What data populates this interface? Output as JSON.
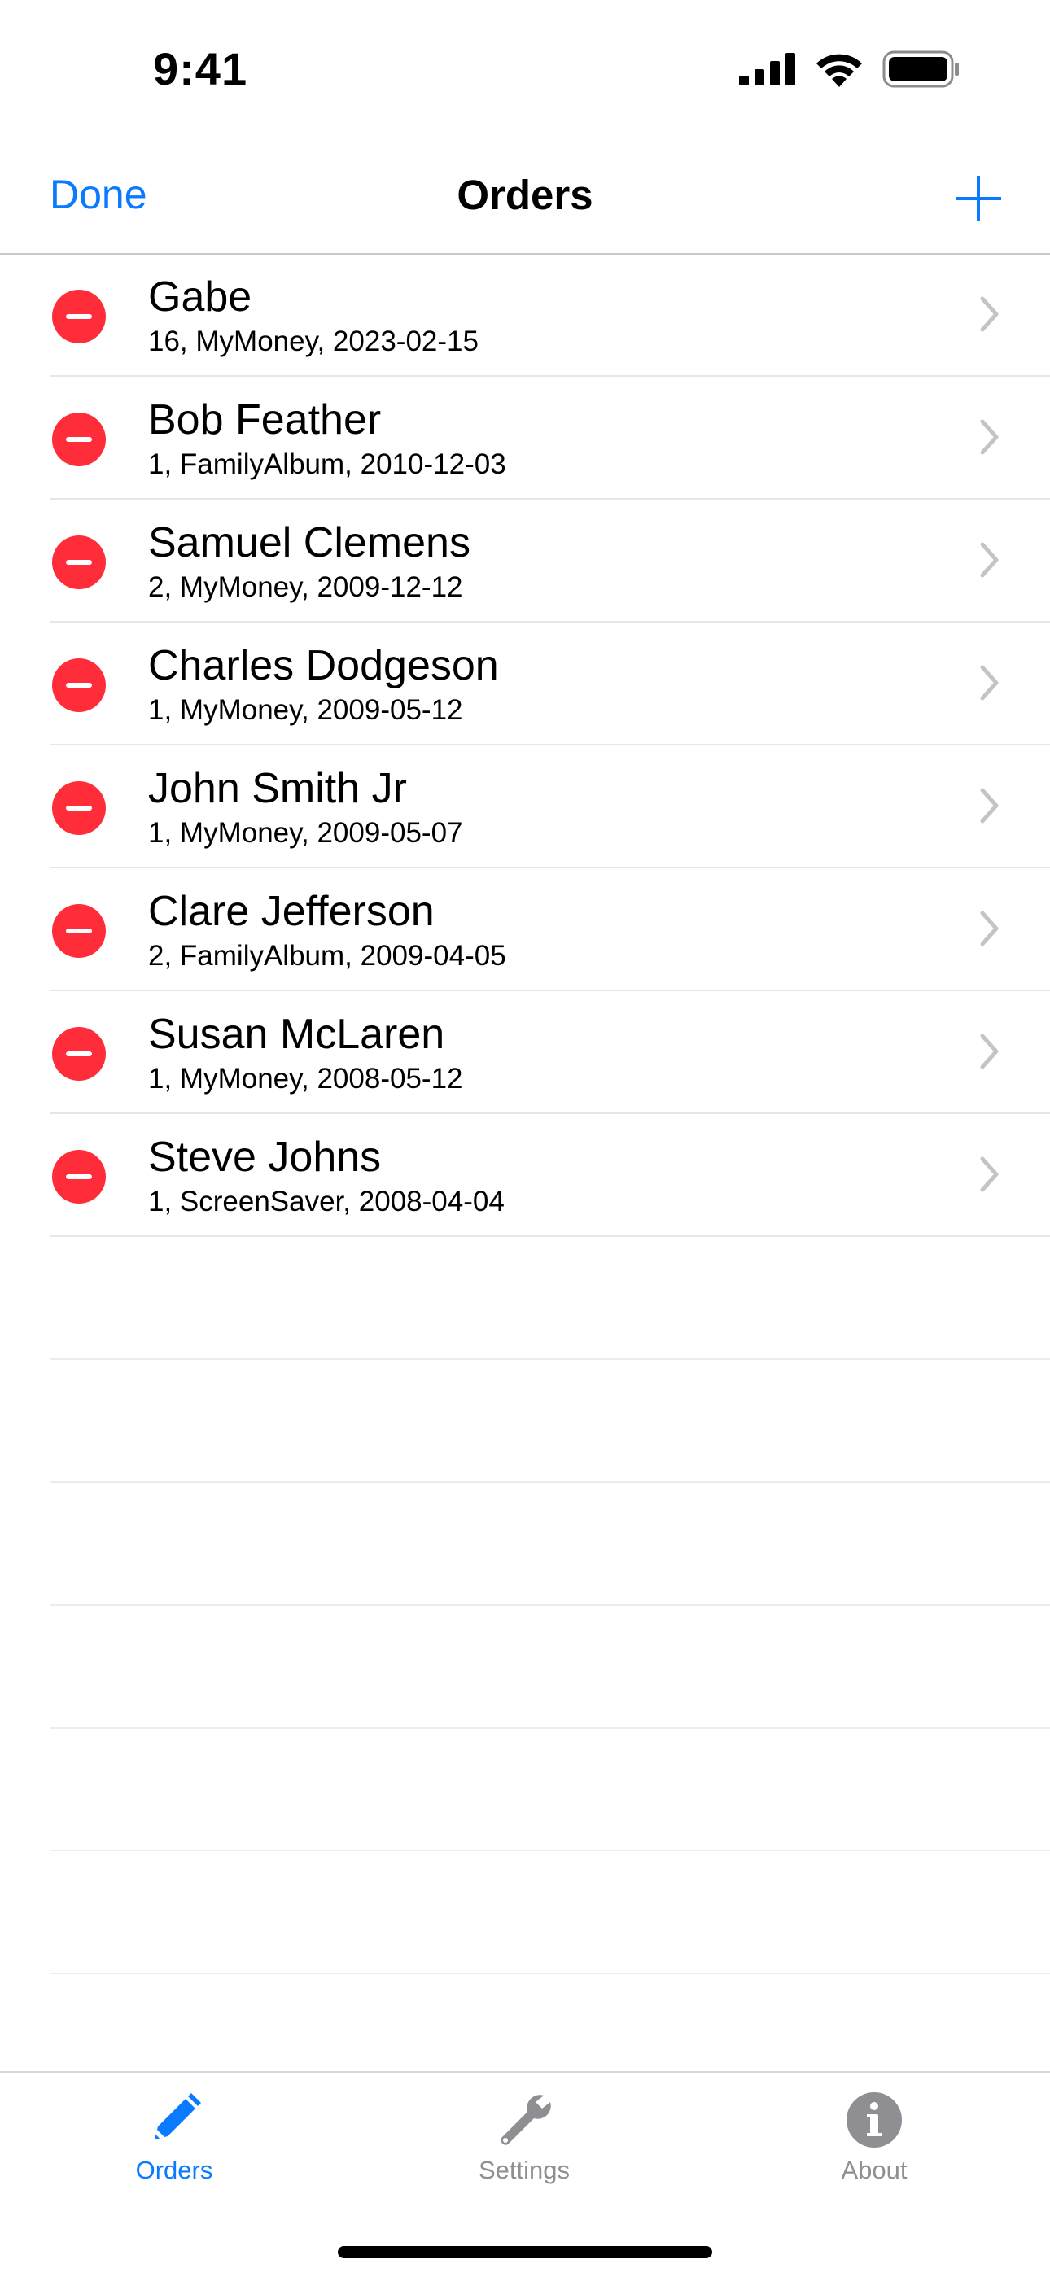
{
  "status_bar": {
    "time": "9:41"
  },
  "nav": {
    "done_label": "Done",
    "title": "Orders",
    "add_icon": "plus-icon"
  },
  "orders": [
    {
      "name": "Gabe",
      "detail": "16, MyMoney, 2023-02-15"
    },
    {
      "name": "Bob Feather",
      "detail": "1, FamilyAlbum, 2010-12-03"
    },
    {
      "name": "Samuel Clemens",
      "detail": "2, MyMoney, 2009-12-12"
    },
    {
      "name": "Charles Dodgeson",
      "detail": "1, MyMoney, 2009-05-12"
    },
    {
      "name": "John Smith Jr",
      "detail": "1, MyMoney, 2009-05-07"
    },
    {
      "name": "Clare Jefferson",
      "detail": "2, FamilyAlbum, 2009-04-05"
    },
    {
      "name": "Susan McLaren",
      "detail": "1, MyMoney, 2008-05-12"
    },
    {
      "name": "Steve Johns",
      "detail": "1, ScreenSaver, 2008-04-04"
    }
  ],
  "tabs": [
    {
      "label": "Orders",
      "icon": "pencil-icon",
      "active": true
    },
    {
      "label": "Settings",
      "icon": "wrench-icon",
      "active": false
    },
    {
      "label": "About",
      "icon": "info-icon",
      "active": false
    }
  ],
  "colors": {
    "accent": "#0a7aff",
    "delete": "#ff2d3a",
    "inactive": "#8e8e93"
  }
}
